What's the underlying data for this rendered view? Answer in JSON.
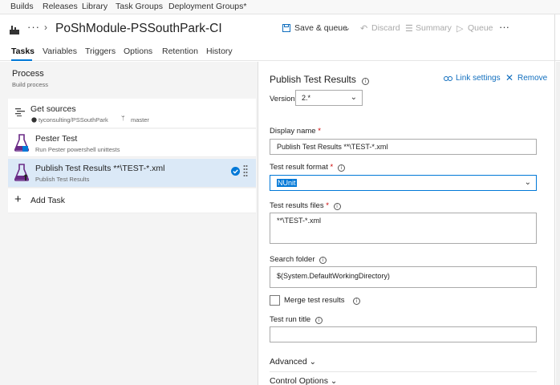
{
  "topnav": {
    "items": [
      "Builds",
      "Releases",
      "Library",
      "Task Groups",
      "Deployment Groups*"
    ]
  },
  "header": {
    "title": "PoShModule-PSSouthPark-CI",
    "more": "···",
    "save_queue": "Save & queue",
    "discard": "Discard",
    "summary": "Summary",
    "queue": "Queue",
    "overflow": "···"
  },
  "tabs": [
    "Tasks",
    "Variables",
    "Triggers",
    "Options",
    "Retention",
    "History"
  ],
  "process": {
    "title": "Process",
    "subtitle": "Build process"
  },
  "tasks": [
    {
      "name": "Get sources",
      "repo": "tyconsulting/PSSouthPark",
      "branch": "master"
    },
    {
      "name": "Pester Test",
      "subtitle": "Run Pester powershell unittests"
    },
    {
      "name": "Publish Test Results **\\TEST-*.xml",
      "subtitle": "Publish Test Results"
    }
  ],
  "add_task": "Add Task",
  "detail": {
    "title": "Publish Test Results",
    "link_settings": "Link settings",
    "remove": "Remove",
    "version_label": "Version",
    "version_value": "2.*",
    "display_name_label": "Display name",
    "display_name_value": "Publish Test Results **\\TEST-*.xml",
    "format_label": "Test result format",
    "format_value": "NUnit",
    "files_label": "Test results files",
    "files_value": "**\\TEST-*.xml",
    "search_label": "Search folder",
    "search_value": "$(System.DefaultWorkingDirectory)",
    "merge_label": "Merge test results",
    "run_title_label": "Test run title",
    "run_title_value": "",
    "advanced": "Advanced",
    "control_options": "Control Options"
  },
  "colors": {
    "accent": "#0078d7",
    "flask": "#6a2a86",
    "selected_row": "#dbe9f7",
    "link": "#106ebe"
  }
}
